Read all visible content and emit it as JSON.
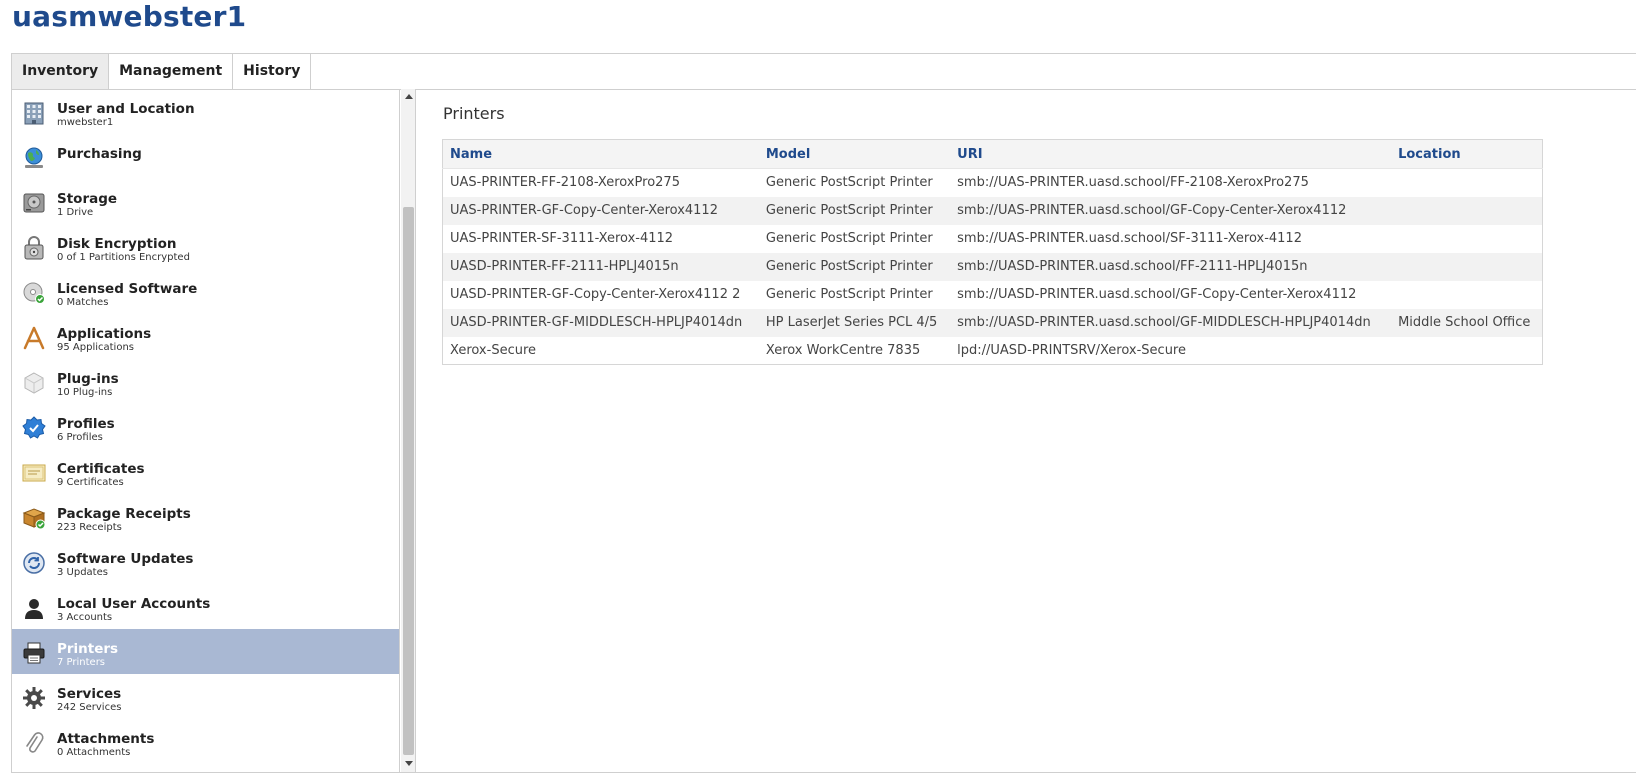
{
  "header": {
    "computer_name": "uasmwebster1"
  },
  "tabs": [
    {
      "label": "Inventory",
      "active": true
    },
    {
      "label": "Management",
      "active": false
    },
    {
      "label": "History",
      "active": false
    }
  ],
  "sidebar": {
    "items": [
      {
        "label": "User and Location",
        "sub": "mwebster1",
        "icon": "building-icon"
      },
      {
        "label": "Purchasing",
        "sub": "",
        "icon": "globe-icon"
      },
      {
        "label": "Storage",
        "sub": "1 Drive",
        "icon": "hard-drive-icon"
      },
      {
        "label": "Disk Encryption",
        "sub": "0 of 1 Partitions Encrypted",
        "icon": "lock-drive-icon"
      },
      {
        "label": "Licensed Software",
        "sub": "0 Matches",
        "icon": "disc-icon"
      },
      {
        "label": "Applications",
        "sub": "95 Applications",
        "icon": "applications-icon"
      },
      {
        "label": "Plug-ins",
        "sub": "10 Plug-ins",
        "icon": "plugin-icon"
      },
      {
        "label": "Profiles",
        "sub": "6 Profiles",
        "icon": "profile-badge-icon"
      },
      {
        "label": "Certificates",
        "sub": "9 Certificates",
        "icon": "certificate-icon"
      },
      {
        "label": "Package Receipts",
        "sub": "223 Receipts",
        "icon": "package-icon"
      },
      {
        "label": "Software Updates",
        "sub": "3 Updates",
        "icon": "software-update-icon"
      },
      {
        "label": "Local User Accounts",
        "sub": "3 Accounts",
        "icon": "user-silhouette-icon"
      },
      {
        "label": "Printers",
        "sub": "7 Printers",
        "icon": "printer-icon",
        "selected": true
      },
      {
        "label": "Services",
        "sub": "242 Services",
        "icon": "gear-icon"
      },
      {
        "label": "Attachments",
        "sub": "0 Attachments",
        "icon": "paperclip-icon"
      }
    ]
  },
  "main": {
    "section_title": "Printers",
    "columns": [
      "Name",
      "Model",
      "URI",
      "Location"
    ],
    "rows": [
      [
        "UAS-PRINTER-FF-2108-XeroxPro275",
        "Generic PostScript Printer",
        "smb://UAS-PRINTER.uasd.school/FF-2108-XeroxPro275",
        ""
      ],
      [
        "UAS-PRINTER-GF-Copy-Center-Xerox4112",
        "Generic PostScript Printer",
        "smb://UAS-PRINTER.uasd.school/GF-Copy-Center-Xerox4112",
        ""
      ],
      [
        "UAS-PRINTER-SF-3111-Xerox-4112",
        "Generic PostScript Printer",
        "smb://UAS-PRINTER.uasd.school/SF-3111-Xerox-4112",
        ""
      ],
      [
        "UASD-PRINTER-FF-2111-HPLJ4015n",
        "Generic PostScript Printer",
        "smb://UASD-PRINTER.uasd.school/FF-2111-HPLJ4015n",
        ""
      ],
      [
        "UASD-PRINTER-GF-Copy-Center-Xerox4112 2",
        "Generic PostScript Printer",
        "smb://UASD-PRINTER.uasd.school/GF-Copy-Center-Xerox4112",
        ""
      ],
      [
        "UASD-PRINTER-GF-MIDDLESCH-HPLJP4014dn",
        "HP LaserJet Series PCL 4/5",
        "smb://UASD-PRINTER.uasd.school/GF-MIDDLESCH-HPLJP4014dn",
        "Middle School Office"
      ],
      [
        "Xerox-Secure",
        "Xerox WorkCentre 7835",
        "lpd://UASD-PRINTSRV/Xerox-Secure",
        ""
      ]
    ]
  },
  "colors": {
    "title_blue": "#1f4a8c",
    "selected_row": "#a9b8d3",
    "table_stripe": "#f2f2f2"
  }
}
